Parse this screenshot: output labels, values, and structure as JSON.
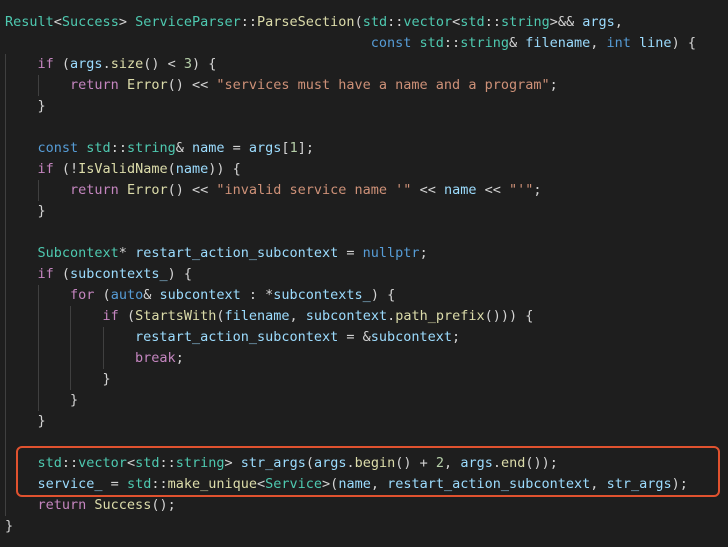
{
  "theme": {
    "background": "#1e1e1e",
    "default": "#d4d4d4",
    "type": "#4ec9b0",
    "function": "#dcdcaa",
    "variable": "#9cdcfe",
    "keyword": "#569cd6",
    "control": "#c586c0",
    "string": "#ce9178",
    "number": "#b5cea8",
    "highlight_border": "#e0522f"
  },
  "lines": [
    {
      "indent": 0,
      "tokens": [
        {
          "t": "Result",
          "c": "type"
        },
        {
          "t": "<",
          "c": "default"
        },
        {
          "t": "Success",
          "c": "type"
        },
        {
          "t": "> ",
          "c": "default"
        },
        {
          "t": "ServiceParser",
          "c": "type"
        },
        {
          "t": "::",
          "c": "default"
        },
        {
          "t": "ParseSection",
          "c": "function"
        },
        {
          "t": "(",
          "c": "default"
        },
        {
          "t": "std",
          "c": "type"
        },
        {
          "t": "::",
          "c": "default"
        },
        {
          "t": "vector",
          "c": "type"
        },
        {
          "t": "<",
          "c": "default"
        },
        {
          "t": "std",
          "c": "type"
        },
        {
          "t": "::",
          "c": "default"
        },
        {
          "t": "string",
          "c": "type"
        },
        {
          "t": ">&& ",
          "c": "default"
        },
        {
          "t": "args",
          "c": "variable"
        },
        {
          "t": ",",
          "c": "default"
        }
      ]
    },
    {
      "indent": 0,
      "tokens": [
        {
          "t": "                                             ",
          "c": "default"
        },
        {
          "t": "const ",
          "c": "keyword"
        },
        {
          "t": "std",
          "c": "type"
        },
        {
          "t": "::",
          "c": "default"
        },
        {
          "t": "string",
          "c": "type"
        },
        {
          "t": "& ",
          "c": "default"
        },
        {
          "t": "filename",
          "c": "variable"
        },
        {
          "t": ", ",
          "c": "default"
        },
        {
          "t": "int ",
          "c": "keyword"
        },
        {
          "t": "line",
          "c": "variable"
        },
        {
          "t": ") {",
          "c": "default"
        }
      ]
    },
    {
      "indent": 1,
      "tokens": [
        {
          "t": "if ",
          "c": "control"
        },
        {
          "t": "(",
          "c": "default"
        },
        {
          "t": "args",
          "c": "variable"
        },
        {
          "t": ".",
          "c": "default"
        },
        {
          "t": "size",
          "c": "function"
        },
        {
          "t": "() < ",
          "c": "default"
        },
        {
          "t": "3",
          "c": "number"
        },
        {
          "t": ") {",
          "c": "default"
        }
      ]
    },
    {
      "indent": 2,
      "tokens": [
        {
          "t": "return ",
          "c": "control"
        },
        {
          "t": "Error",
          "c": "function"
        },
        {
          "t": "() << ",
          "c": "default"
        },
        {
          "t": "\"services must have a name and a program\"",
          "c": "string"
        },
        {
          "t": ";",
          "c": "default"
        }
      ]
    },
    {
      "indent": 1,
      "tokens": [
        {
          "t": "}",
          "c": "default"
        }
      ]
    },
    {
      "indent": 0,
      "tokens": []
    },
    {
      "indent": 1,
      "tokens": [
        {
          "t": "const ",
          "c": "keyword"
        },
        {
          "t": "std",
          "c": "type"
        },
        {
          "t": "::",
          "c": "default"
        },
        {
          "t": "string",
          "c": "type"
        },
        {
          "t": "& ",
          "c": "default"
        },
        {
          "t": "name",
          "c": "variable"
        },
        {
          "t": " = ",
          "c": "default"
        },
        {
          "t": "args",
          "c": "variable"
        },
        {
          "t": "[",
          "c": "default"
        },
        {
          "t": "1",
          "c": "number"
        },
        {
          "t": "];",
          "c": "default"
        }
      ]
    },
    {
      "indent": 1,
      "tokens": [
        {
          "t": "if ",
          "c": "control"
        },
        {
          "t": "(!",
          "c": "default"
        },
        {
          "t": "IsValidName",
          "c": "function"
        },
        {
          "t": "(",
          "c": "default"
        },
        {
          "t": "name",
          "c": "variable"
        },
        {
          "t": ")) {",
          "c": "default"
        }
      ]
    },
    {
      "indent": 2,
      "tokens": [
        {
          "t": "return ",
          "c": "control"
        },
        {
          "t": "Error",
          "c": "function"
        },
        {
          "t": "() << ",
          "c": "default"
        },
        {
          "t": "\"invalid service name '\"",
          "c": "string"
        },
        {
          "t": " << ",
          "c": "default"
        },
        {
          "t": "name",
          "c": "variable"
        },
        {
          "t": " << ",
          "c": "default"
        },
        {
          "t": "\"'\"",
          "c": "string"
        },
        {
          "t": ";",
          "c": "default"
        }
      ]
    },
    {
      "indent": 1,
      "tokens": [
        {
          "t": "}",
          "c": "default"
        }
      ]
    },
    {
      "indent": 0,
      "tokens": []
    },
    {
      "indent": 1,
      "tokens": [
        {
          "t": "Subcontext",
          "c": "type"
        },
        {
          "t": "* ",
          "c": "default"
        },
        {
          "t": "restart_action_subcontext",
          "c": "variable"
        },
        {
          "t": " = ",
          "c": "default"
        },
        {
          "t": "nullptr",
          "c": "keyword"
        },
        {
          "t": ";",
          "c": "default"
        }
      ]
    },
    {
      "indent": 1,
      "tokens": [
        {
          "t": "if ",
          "c": "control"
        },
        {
          "t": "(",
          "c": "default"
        },
        {
          "t": "subcontexts_",
          "c": "variable"
        },
        {
          "t": ") {",
          "c": "default"
        }
      ]
    },
    {
      "indent": 2,
      "tokens": [
        {
          "t": "for ",
          "c": "control"
        },
        {
          "t": "(",
          "c": "default"
        },
        {
          "t": "auto",
          "c": "keyword"
        },
        {
          "t": "& ",
          "c": "default"
        },
        {
          "t": "subcontext",
          "c": "variable"
        },
        {
          "t": " : *",
          "c": "default"
        },
        {
          "t": "subcontexts_",
          "c": "variable"
        },
        {
          "t": ") {",
          "c": "default"
        }
      ]
    },
    {
      "indent": 3,
      "tokens": [
        {
          "t": "if ",
          "c": "control"
        },
        {
          "t": "(",
          "c": "default"
        },
        {
          "t": "StartsWith",
          "c": "function"
        },
        {
          "t": "(",
          "c": "default"
        },
        {
          "t": "filename",
          "c": "variable"
        },
        {
          "t": ", ",
          "c": "default"
        },
        {
          "t": "subcontext",
          "c": "variable"
        },
        {
          "t": ".",
          "c": "default"
        },
        {
          "t": "path_prefix",
          "c": "function"
        },
        {
          "t": "())) {",
          "c": "default"
        }
      ]
    },
    {
      "indent": 4,
      "tokens": [
        {
          "t": "restart_action_subcontext",
          "c": "variable"
        },
        {
          "t": " = &",
          "c": "default"
        },
        {
          "t": "subcontext",
          "c": "variable"
        },
        {
          "t": ";",
          "c": "default"
        }
      ]
    },
    {
      "indent": 4,
      "tokens": [
        {
          "t": "break",
          "c": "control"
        },
        {
          "t": ";",
          "c": "default"
        }
      ]
    },
    {
      "indent": 3,
      "tokens": [
        {
          "t": "}",
          "c": "default"
        }
      ]
    },
    {
      "indent": 2,
      "tokens": [
        {
          "t": "}",
          "c": "default"
        }
      ]
    },
    {
      "indent": 1,
      "tokens": [
        {
          "t": "}",
          "c": "default"
        }
      ]
    },
    {
      "indent": 0,
      "tokens": []
    },
    {
      "indent": 1,
      "tokens": [
        {
          "t": "std",
          "c": "type"
        },
        {
          "t": "::",
          "c": "default"
        },
        {
          "t": "vector",
          "c": "type"
        },
        {
          "t": "<",
          "c": "default"
        },
        {
          "t": "std",
          "c": "type"
        },
        {
          "t": "::",
          "c": "default"
        },
        {
          "t": "string",
          "c": "type"
        },
        {
          "t": "> ",
          "c": "default"
        },
        {
          "t": "str_args",
          "c": "variable"
        },
        {
          "t": "(",
          "c": "default"
        },
        {
          "t": "args",
          "c": "variable"
        },
        {
          "t": ".",
          "c": "default"
        },
        {
          "t": "begin",
          "c": "function"
        },
        {
          "t": "() + ",
          "c": "default"
        },
        {
          "t": "2",
          "c": "number"
        },
        {
          "t": ", ",
          "c": "default"
        },
        {
          "t": "args",
          "c": "variable"
        },
        {
          "t": ".",
          "c": "default"
        },
        {
          "t": "end",
          "c": "function"
        },
        {
          "t": "());",
          "c": "default"
        }
      ]
    },
    {
      "indent": 1,
      "tokens": [
        {
          "t": "service_",
          "c": "variable"
        },
        {
          "t": " = ",
          "c": "default"
        },
        {
          "t": "std",
          "c": "type"
        },
        {
          "t": "::",
          "c": "default"
        },
        {
          "t": "make_unique",
          "c": "function"
        },
        {
          "t": "<",
          "c": "default"
        },
        {
          "t": "Service",
          "c": "type"
        },
        {
          "t": ">(",
          "c": "default"
        },
        {
          "t": "name",
          "c": "variable"
        },
        {
          "t": ", ",
          "c": "default"
        },
        {
          "t": "restart_action_subcontext",
          "c": "variable"
        },
        {
          "t": ", ",
          "c": "default"
        },
        {
          "t": "str_args",
          "c": "variable"
        },
        {
          "t": ");",
          "c": "default"
        }
      ]
    },
    {
      "indent": 1,
      "tokens": [
        {
          "t": "return ",
          "c": "control"
        },
        {
          "t": "Success",
          "c": "function"
        },
        {
          "t": "();",
          "c": "default"
        }
      ]
    },
    {
      "indent": 0,
      "tokens": [
        {
          "t": "}",
          "c": "default"
        }
      ]
    }
  ]
}
